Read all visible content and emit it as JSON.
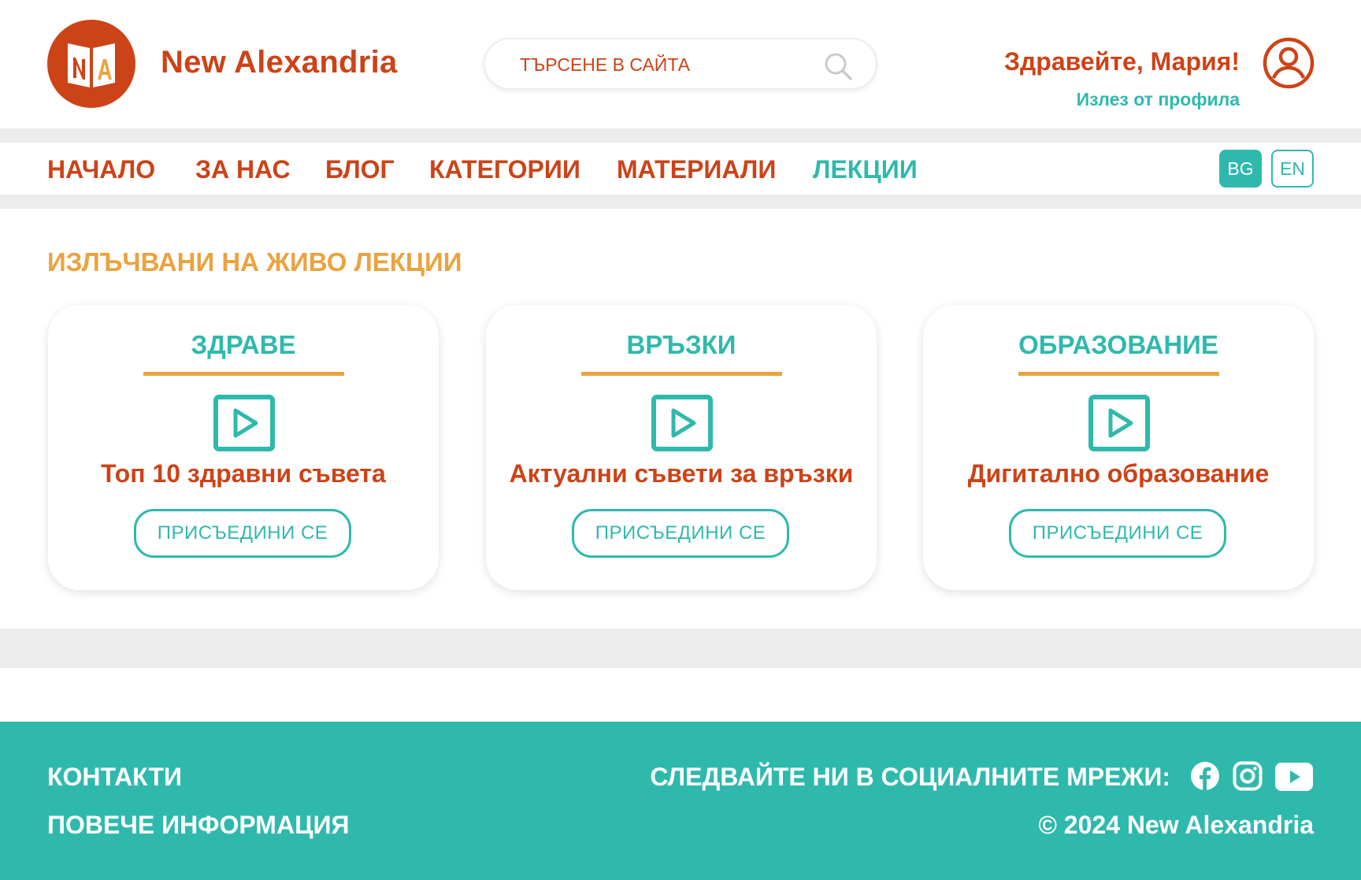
{
  "header": {
    "logo": {
      "letters": "NA",
      "icon": "open-book-logo-icon"
    },
    "site_name": "New Alexandria",
    "search": {
      "placeholder": "ТЪРСЕНЕ В САЙТА",
      "value": "",
      "icon": "search-icon"
    },
    "greeting": "Здравейте, Мария!",
    "logout_label": "Излез от профила",
    "user_icon": "user-profile-icon"
  },
  "nav": {
    "items": [
      {
        "label": "НАЧАЛО",
        "active": false
      },
      {
        "label": "ЗА НАС",
        "active": false
      },
      {
        "label": "БЛОГ",
        "active": false
      },
      {
        "label": "КАТЕГОРИИ",
        "active": false
      },
      {
        "label": "МАТЕРИАЛИ",
        "active": false
      },
      {
        "label": "ЛЕКЦИИ",
        "active": true
      }
    ],
    "languages": [
      {
        "label": "BG",
        "selected": true
      },
      {
        "label": "EN",
        "selected": false
      }
    ]
  },
  "main": {
    "section_title": "ИЗЛЪЧВАНИ НА ЖИВО ЛЕКЦИИ",
    "cards": [
      {
        "category": "ЗДРАВЕ",
        "title": "Топ 10 здравни съвета",
        "button_label": "ПРИСЪЕДИНИ СЕ",
        "icon": "play-icon"
      },
      {
        "category": "ВРЪЗКИ",
        "title": "Актуални съвети за връзки",
        "button_label": "ПРИСЪЕДИНИ СЕ",
        "icon": "play-icon"
      },
      {
        "category": "ОБРАЗОВАНИЕ",
        "title": "Дигитално образование",
        "button_label": "ПРИСЪЕДИНИ СЕ",
        "icon": "play-icon"
      }
    ]
  },
  "footer": {
    "links": [
      "КОНТАКТИ",
      "ПОВЕЧЕ ИНФОРМАЦИЯ"
    ],
    "follow_label": "СЛЕДВАЙТЕ НИ В СОЦИАЛНИТЕ МРЕЖИ:",
    "social_icons": [
      "facebook-icon",
      "instagram-icon",
      "youtube-icon"
    ],
    "copyright": "©  2024  New Alexandria"
  },
  "colors": {
    "brand_orange": "#cc4317",
    "teal": "#2fb9ad",
    "amber": "#eba33f",
    "band_grey": "#ececec"
  }
}
